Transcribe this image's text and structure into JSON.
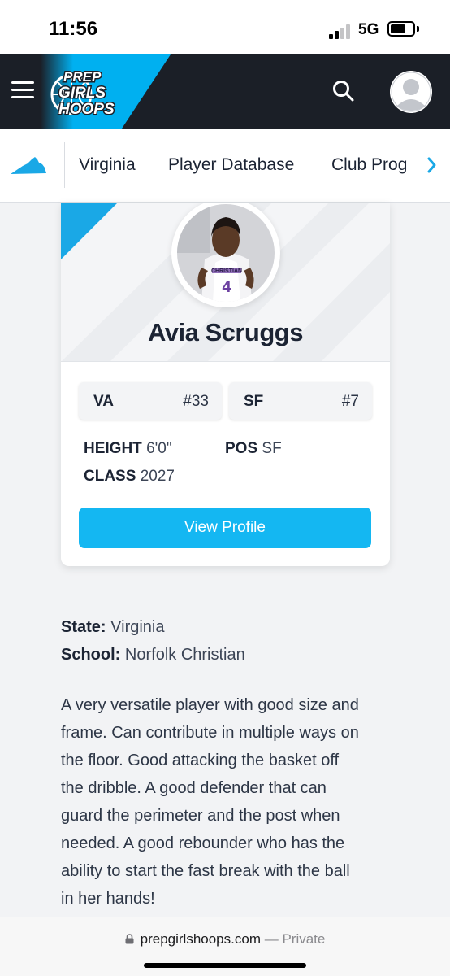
{
  "status_bar": {
    "time": "11:56",
    "network": "5G"
  },
  "header": {
    "logo_lines": [
      "PREP",
      "GIRLS",
      "HOOPS"
    ],
    "accent_color": "#00b0f0",
    "background_color": "#1b1f27",
    "menu_icon": "hamburger-icon",
    "search_icon": "search-icon",
    "account_icon": "user-avatar-icon"
  },
  "sub_nav": {
    "state_icon": "virginia-state-icon",
    "items": [
      {
        "label": "Virginia"
      },
      {
        "label": "Player Database"
      },
      {
        "label": "Club Prog"
      }
    ],
    "next_icon": "chevron-right-icon"
  },
  "profile": {
    "name": "Avia Scruggs",
    "jersey_text": "CHRISTIAN",
    "jersey_number": "4",
    "rankings": [
      {
        "label": "VA",
        "value": "#33"
      },
      {
        "label": "SF",
        "value": "#7"
      }
    ],
    "stats": {
      "height_label": "HEIGHT",
      "height_value": "6'0\"",
      "pos_label": "POS",
      "pos_value": "SF",
      "class_label": "CLASS",
      "class_value": "2027"
    },
    "button_label": "View Profile",
    "button_color": "#14b7f2"
  },
  "details": {
    "state_label": "State:",
    "state_value": "Virginia",
    "school_label": "School:",
    "school_value": "Norfolk Christian",
    "bio_lines": [
      "A very versatile player with good size and",
      "frame. Can contribute in multiple ways on",
      "the floor. Good attacking the basket off",
      "the dribble. A good defender that can",
      "guard the perimeter and the post when",
      "needed. A good rebounder who has the",
      "ability to start the fast break with the ball",
      "in her hands!"
    ]
  },
  "browser": {
    "url": "prepgirlshoops.com",
    "mode": "— Private",
    "lock_icon": "lock-icon"
  }
}
